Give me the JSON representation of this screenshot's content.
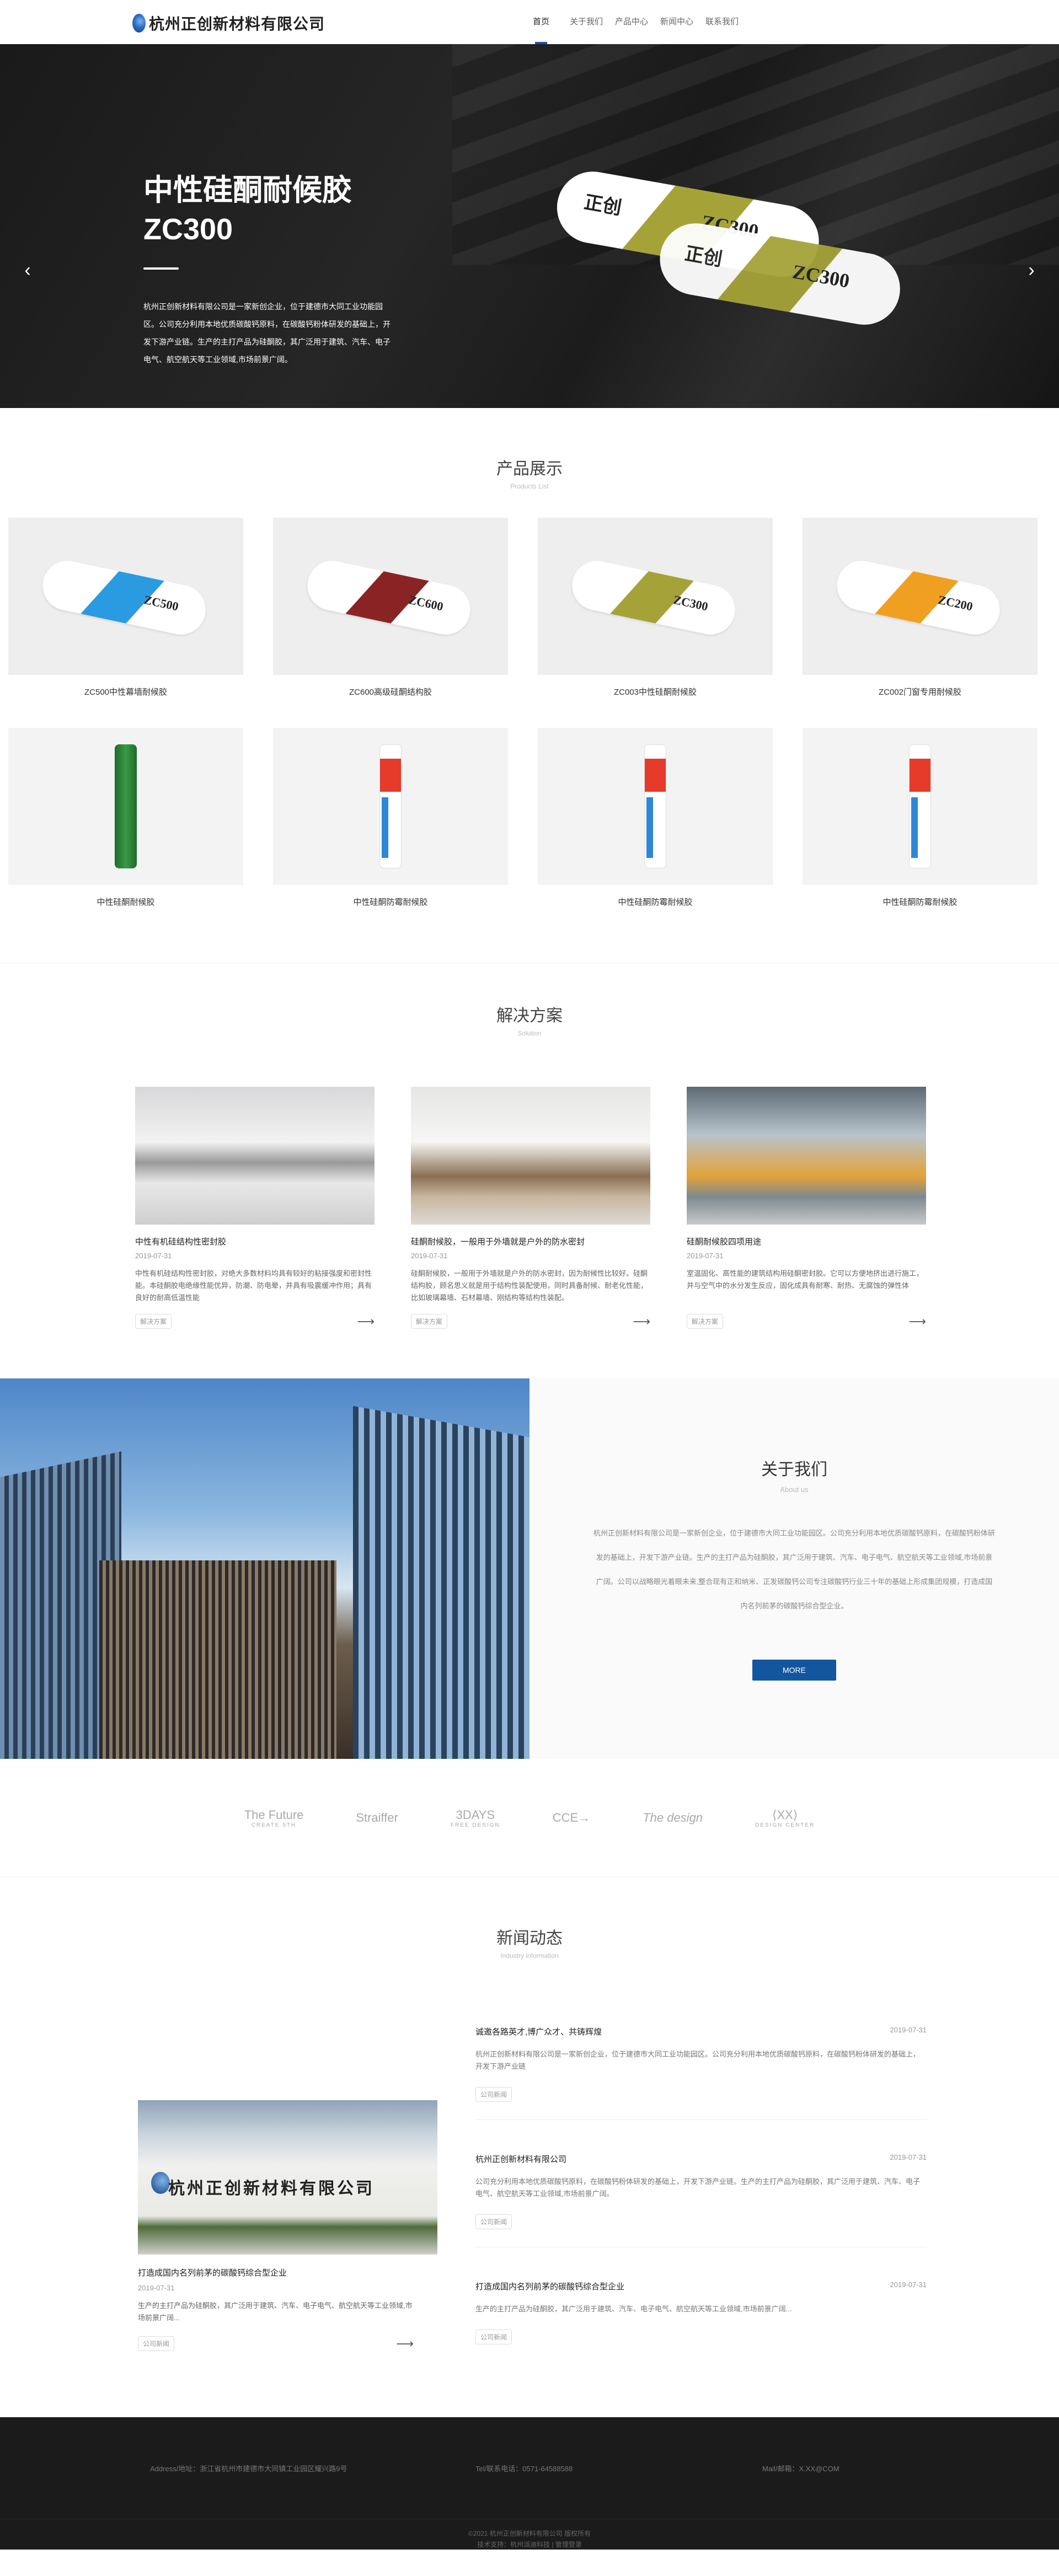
{
  "header": {
    "logo_text": "杭州正创新材料有限公司",
    "nav": [
      {
        "label": "首页",
        "active": true
      },
      {
        "label": "关于我们"
      },
      {
        "label": "产品中心"
      },
      {
        "label": "新闻中心"
      },
      {
        "label": "联系我们"
      }
    ]
  },
  "hero": {
    "title": "中性硅酮耐候胶",
    "subtitle": "ZC300",
    "description": "杭州正创新材料有限公司是一家新创企业，位于建德市大同工业功能园区。公司充分利用本地优质碳酸钙原料，在碳酸钙粉体研发的基础上，开发下游产业链。生产的主打产品为硅酮胶，其广泛用于建筑、汽车、电子电气、航空航天等工业领域,市场前景广阔。",
    "product_brand": "正创",
    "product_model": "ZC300",
    "prev_icon": "‹",
    "next_icon": "›"
  },
  "products": {
    "title": "产品展示",
    "subtitle": "Products List",
    "items": [
      {
        "name": "ZC500中性幕墙耐候胶",
        "model": "ZC500",
        "color": "#2a9be0"
      },
      {
        "name": "ZC600高级硅酮结构胶",
        "model": "ZC600",
        "color": "#8a2424"
      },
      {
        "name": "ZC003中性硅酮耐候胶",
        "model": "ZC300",
        "color": "#a5a338"
      },
      {
        "name": "ZC002门窗专用耐候胶",
        "model": "ZC200",
        "color": "#f0a020"
      },
      {
        "name": "中性硅酮耐候胶",
        "type": "green"
      },
      {
        "name": "中性硅酮防霉耐候胶",
        "type": "white"
      },
      {
        "name": "中性硅酮防霉耐候胶",
        "type": "white"
      },
      {
        "name": "中性硅酮防霉耐候胶",
        "type": "white"
      }
    ]
  },
  "solutions": {
    "title": "解决方案",
    "subtitle": "Solution",
    "items": [
      {
        "title": "中性有机硅结构性密封胶",
        "date": "2019-07-31",
        "desc": "中性有机硅结构性密封胶，对绝大多数材料均具有较好的粘接强度和密封性能。本硅酮胶电绝缘性能优异，防潮、防电晕，并具有吸震缓冲作用；具有良好的耐高低温性能",
        "tag": "解决方案"
      },
      {
        "title": "硅酮耐候胶，一般用于外墙就是户外的防水密封",
        "date": "2019-07-31",
        "desc": "硅酮耐候胶，一般用于外墙就是户外的防水密封，因为耐候性比较好。硅酮结构胶，顾名思义就是用于结构性装配使用，同时具备耐候、耐老化性能，比如玻璃幕墙、石材幕墙、刚结构等结构性装配。",
        "tag": "解决方案"
      },
      {
        "title": "硅酮耐候胶四项用途",
        "date": "2019-07-31",
        "desc": "室温固化、高性能的建筑结构用硅酮密封胶。它可以方便地挤出进行施工，并与空气中的水分发生反应，固化成具有耐寒、耐热、无腐蚀的弹性体",
        "tag": "解决方案"
      }
    ],
    "arrow_icon": "⟶"
  },
  "about": {
    "title": "关于我们",
    "subtitle": "About us",
    "description": "杭州正创新材料有限公司是一家新创企业，位于建德市大同工业功能园区。公司充分利用本地优质碳酸钙原料，在碳酸钙粉体研发的基础上，开发下游产业链。生产的主打产品为硅酮胶，其广泛用于建筑、汽车、电子电气、航空航天等工业领域,市场前景广阔。公司以战略眼光着眼未来,整合现有正和纳米、正发碳酸钙公司专注碳酸钙行业三十年的基础上形成集团规模，打造成国内名列前茅的碳酸钙综合型企业。",
    "more_label": "MORE"
  },
  "partners": [
    {
      "name": "The Future",
      "sub": "CREATE 5TH"
    },
    {
      "name": "Straiffer",
      "sub": ""
    },
    {
      "name": "3DAYS",
      "sub": "FREE DESIGN"
    },
    {
      "name": "CCE→",
      "sub": ""
    },
    {
      "name": "The design",
      "sub": ""
    },
    {
      "name": "⟨XX⟩",
      "sub": "DESIGN CENTER"
    }
  ],
  "news": {
    "title": "新闻动态",
    "subtitle": "Industry information",
    "feature": {
      "image_sign": "杭州正创新材料有限公司",
      "title": "打造成国内名列前茅的碳酸钙综合型企业",
      "date": "2019-07-31",
      "desc": "生产的主打产品为硅酮胶，其广泛用于建筑、汽车、电子电气、航空航天等工业领域,市场前景广阔...",
      "tag": "公司新闻"
    },
    "items": [
      {
        "title": "诚邀各路英才,博广众才、共铸辉煌",
        "date": "2019-07-31",
        "desc": "杭州正创新材料有限公司是一家新创企业，位于建德市大同工业功能园区。公司充分利用本地优质碳酸钙原料，在碳酸钙粉体研发的基础上，开发下游产业链",
        "tag": "公司新闻"
      },
      {
        "title": "杭州正创新材料有限公司",
        "date": "2019-07-31",
        "desc": "公司充分利用本地优质碳酸钙原料，在碳酸钙粉体研发的基础上，开发下游产业链。生产的主打产品为硅酮胶，其广泛用于建筑、汽车、电子电气、航空航天等工业领域,市场前景广阔。",
        "tag": "公司新闻"
      },
      {
        "title": "打造成国内名列前茅的碳酸钙综合型企业",
        "date": "2019-07-31",
        "desc": "生产的主打产品为硅酮胶，其广泛用于建筑、汽车、电子电气、航空航天等工业领域,市场前景广阔...",
        "tag": "公司新闻"
      }
    ]
  },
  "footer": {
    "address": "Address/地址：浙江省杭州市建德市大同镇工业园区耀兴路9号",
    "tel": "Tel/联系电话：0571-64588588",
    "mail": "Mail/邮箱：X.XX@COM",
    "copyright": "©2021 杭州正创新材料有限公司 版权所有",
    "support_label": "技术支持：",
    "support_link": "杭州派迪科技",
    "separator": "|",
    "admin_link": "管理登录"
  }
}
